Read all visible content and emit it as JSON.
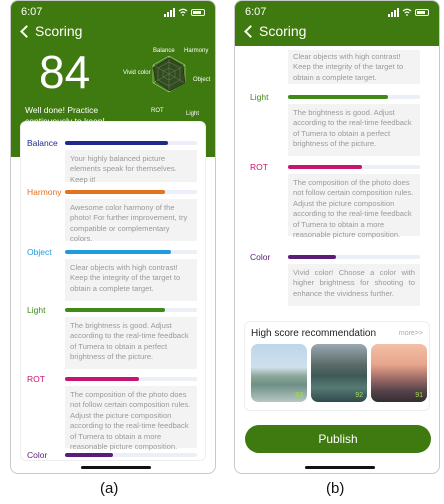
{
  "status": {
    "time": "6:07"
  },
  "header": {
    "title": "Scoring"
  },
  "score": {
    "value": "84",
    "message": "Well done! Practice continuously to keep!"
  },
  "radar": {
    "labels": {
      "balance": "Balance",
      "harmony": "Harmony",
      "vivid": "Vivid color",
      "object": "Object",
      "rot": "ROT",
      "light": "Light"
    }
  },
  "metrics": [
    {
      "label": "Balance",
      "label_color": "#1f2a8c",
      "bar_color": "#1f2a8c",
      "fraction": 0.78,
      "desc": "Your highly balanced picture elements speak for themselves. Keep it!"
    },
    {
      "label": "Harmony",
      "label_color": "#e5701e",
      "bar_color": "#e5701e",
      "fraction": 0.76,
      "desc": "Awesome color harmony of the photo! For further improvement, try compatible or complementary colors."
    },
    {
      "label": "Object",
      "label_color": "#1f9be0",
      "bar_color": "#1f9be0",
      "fraction": 0.8,
      "desc": "Clear objects with high contrast! Keep the integrity of the target to obtain a complete target."
    },
    {
      "label": "Light",
      "label_color": "#3f8a16",
      "bar_color": "#3f8a16",
      "fraction": 0.76,
      "desc": "The brightness is good. Adjust according to the real-time feedback of Tumera to obtain a perfect brightness of the picture."
    },
    {
      "label": "ROT",
      "label_color": "#c8136f",
      "bar_color": "#c8136f",
      "fraction": 0.56,
      "desc": "The composition of the photo does not follow certain composition rules. Adjust the picture composition according to the real-time feedback of Tumera to obtain a more reasonable picture composition."
    },
    {
      "label": "Color",
      "label_color": "#5a1e78",
      "bar_color": "#5a1e78",
      "fraction": 0.36,
      "desc": "Vivid color! Choose a color with higher brightness for shooting to enhance the vividness further."
    }
  ],
  "recommendation": {
    "title": "High score recommendation",
    "more": "more>>",
    "items": [
      {
        "score": "93"
      },
      {
        "score": "92"
      },
      {
        "score": "91"
      }
    ]
  },
  "publish_label": "Publish",
  "captions": {
    "a": "(a)",
    "b": "(b)"
  }
}
